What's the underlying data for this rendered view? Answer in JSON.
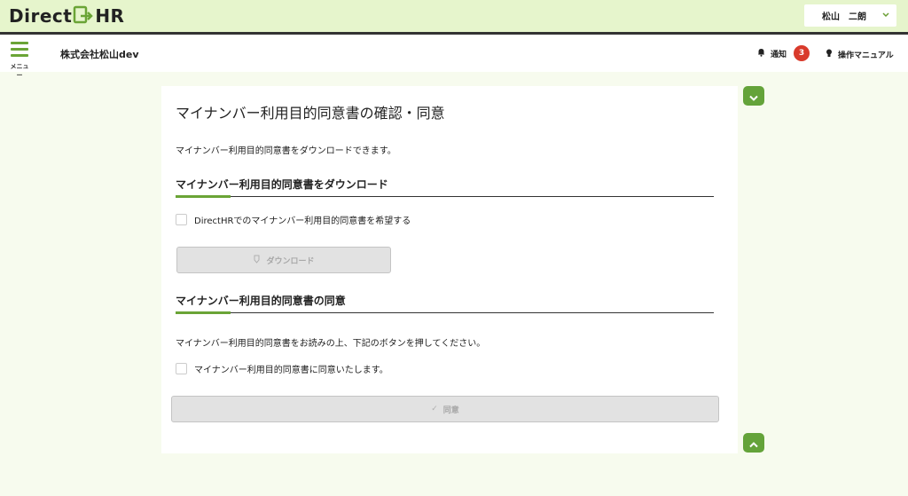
{
  "header": {
    "logo_left": "Direct",
    "logo_right": "HR",
    "user_name": "松山　二朗",
    "menu_label": "メニュー",
    "company": "株式会社松山dev",
    "notify_label": "通知",
    "notify_count": "3",
    "manual_label": "操作マニュアル"
  },
  "page": {
    "title": "マイナンバー利用目的同意書の確認・同意",
    "intro": "マイナンバー利用目的同意書をダウンロードできます。"
  },
  "download_section": {
    "title": "マイナンバー利用目的同意書をダウンロード",
    "checkbox_label": "DirectHRでのマイナンバー利用目的同意書を希望する",
    "button_label": "ダウンロード"
  },
  "consent_section": {
    "title": "マイナンバー利用目的同意書の同意",
    "instruction": "マイナンバー利用目的同意書をお読みの上、下記のボタンを押してください。",
    "checkbox_label": "マイナンバー利用目的同意書に同意いたします。",
    "button_label": "同意"
  },
  "colors": {
    "accent": "#6aa436",
    "header_bg": "#e6f5cc",
    "badge": "#d93a2b"
  },
  "icons": [
    "bell-icon",
    "lightbulb-icon",
    "chevron-down-icon",
    "chevron-up-icon",
    "download-icon",
    "check-icon",
    "hamburger-icon"
  ]
}
